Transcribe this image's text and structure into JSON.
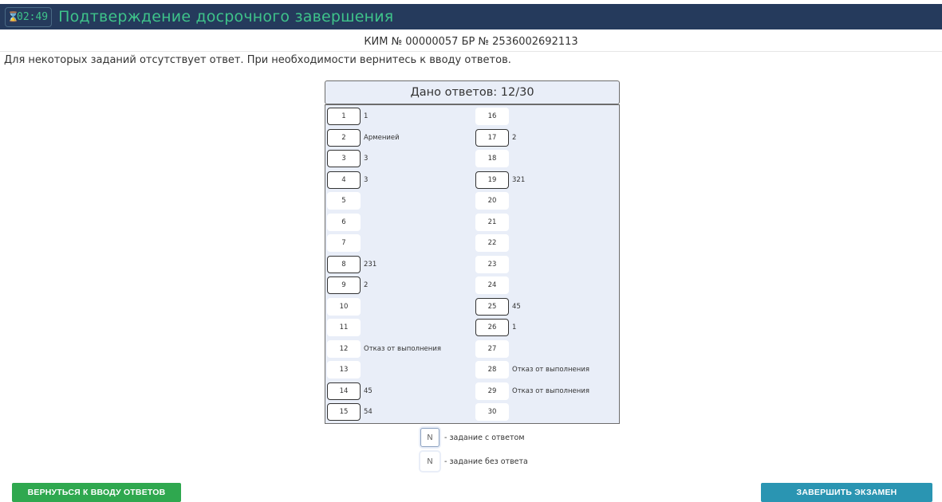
{
  "header": {
    "timer": "02:49",
    "title": "Подтверждение досрочного завершения"
  },
  "kim_line": "КИМ № 00000057 БР № 2536002692113",
  "notice": "Для некоторых заданий отсутствует ответ. При необходимости вернитесь к вводу ответов.",
  "summary": {
    "label": "Дано ответов: 12/30"
  },
  "tasks": [
    {
      "n": "1",
      "answer": "1",
      "answered": true
    },
    {
      "n": "2",
      "answer": "Арменией",
      "answered": true
    },
    {
      "n": "3",
      "answer": "3",
      "answered": true
    },
    {
      "n": "4",
      "answer": "3",
      "answered": true
    },
    {
      "n": "5",
      "answer": "",
      "answered": false
    },
    {
      "n": "6",
      "answer": "",
      "answered": false
    },
    {
      "n": "7",
      "answer": "",
      "answered": false
    },
    {
      "n": "8",
      "answer": "231",
      "answered": true
    },
    {
      "n": "9",
      "answer": "2",
      "answered": true
    },
    {
      "n": "10",
      "answer": "",
      "answered": false
    },
    {
      "n": "11",
      "answer": "",
      "answered": false
    },
    {
      "n": "12",
      "answer": "Отказ от выполнения",
      "answered": false
    },
    {
      "n": "13",
      "answer": "",
      "answered": false
    },
    {
      "n": "14",
      "answer": "45",
      "answered": true
    },
    {
      "n": "15",
      "answer": "54",
      "answered": true
    },
    {
      "n": "16",
      "answer": "",
      "answered": false
    },
    {
      "n": "17",
      "answer": "2",
      "answered": true
    },
    {
      "n": "18",
      "answer": "",
      "answered": false
    },
    {
      "n": "19",
      "answer": "321",
      "answered": true
    },
    {
      "n": "20",
      "answer": "",
      "answered": false
    },
    {
      "n": "21",
      "answer": "",
      "answered": false
    },
    {
      "n": "22",
      "answer": "",
      "answered": false
    },
    {
      "n": "23",
      "answer": "",
      "answered": false
    },
    {
      "n": "24",
      "answer": "",
      "answered": false
    },
    {
      "n": "25",
      "answer": "45",
      "answered": true
    },
    {
      "n": "26",
      "answer": "1",
      "answered": true
    },
    {
      "n": "27",
      "answer": "",
      "answered": false
    },
    {
      "n": "28",
      "answer": "Отказ от выполнения",
      "answered": false
    },
    {
      "n": "29",
      "answer": "Отказ от выполнения",
      "answered": false
    },
    {
      "n": "30",
      "answer": "",
      "answered": false
    }
  ],
  "legend": {
    "with_answer_symbol": "N",
    "with_answer_text": "- задание с ответом",
    "without_answer_symbol": "N",
    "without_answer_text": "- задание без ответа"
  },
  "buttons": {
    "back_label": "ВЕРНУТЬСЯ К ВВОДУ ОТВЕТОВ",
    "finish_label": "ЗАВЕРШИТЬ ЭКЗАМЕН"
  },
  "colors": {
    "header_bg": "#253a5c",
    "title_green": "#3ec38a",
    "back_button": "#2fa84f",
    "finish_button": "#2a95b2",
    "panel_bg": "#e9eef8"
  }
}
